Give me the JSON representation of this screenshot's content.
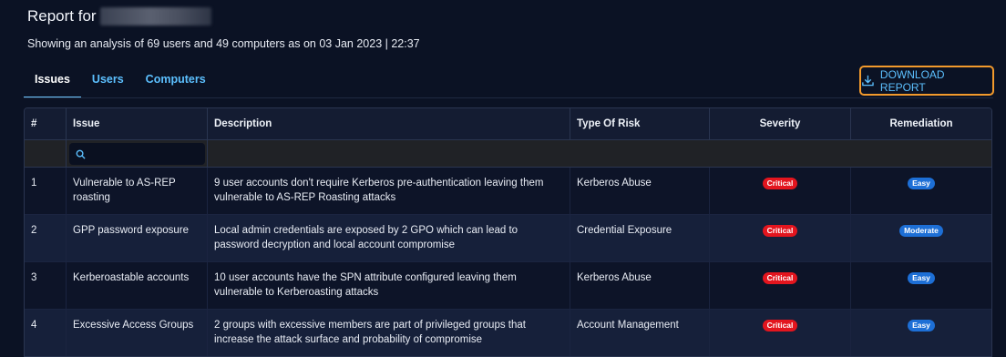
{
  "header": {
    "title": "Report for",
    "subtitle": "Showing an analysis of 69 users and 49 computers as on 03 Jan 2023 | 22:37"
  },
  "tabs": [
    {
      "label": "Issues",
      "active": true
    },
    {
      "label": "Users",
      "active": false
    },
    {
      "label": "Computers",
      "active": false
    }
  ],
  "download": {
    "label": "DOWNLOAD REPORT",
    "icon": "download-icon"
  },
  "table": {
    "columns": [
      "#",
      "Issue",
      "Description",
      "Type Of Risk",
      "Severity",
      "Remediation"
    ],
    "search": {
      "placeholder": "",
      "icon": "search-icon"
    },
    "rows": [
      {
        "num": "1",
        "issue": "Vulnerable to AS-REP roasting",
        "description": "9 user accounts don't require Kerberos pre-authentication leaving them vulnerable to AS-REP Roasting attacks",
        "risk": "Kerberos Abuse",
        "severity": "Critical",
        "remediation": "Easy"
      },
      {
        "num": "2",
        "issue": "GPP password exposure",
        "description": "Local admin credentials are exposed by 2 GPO which can lead to password decryption and local account compromise",
        "risk": "Credential Exposure",
        "severity": "Critical",
        "remediation": "Moderate"
      },
      {
        "num": "3",
        "issue": "Kerberoastable accounts",
        "description": "10 user accounts have the SPN attribute configured leaving them vulnerable to Kerberoasting attacks",
        "risk": "Kerberos Abuse",
        "severity": "Critical",
        "remediation": "Easy"
      },
      {
        "num": "4",
        "issue": "Excessive Access Groups",
        "description": "2 groups with excessive members are part of privileged groups that increase the attack surface and probability of compromise",
        "risk": "Account Management",
        "severity": "Critical",
        "remediation": "Easy"
      }
    ]
  },
  "colors": {
    "background": "#0b1224",
    "accent": "#5cc0ff",
    "critical": "#e3151e",
    "remediation_badge": "#1d6fd6",
    "download_border": "#f39a2c"
  }
}
